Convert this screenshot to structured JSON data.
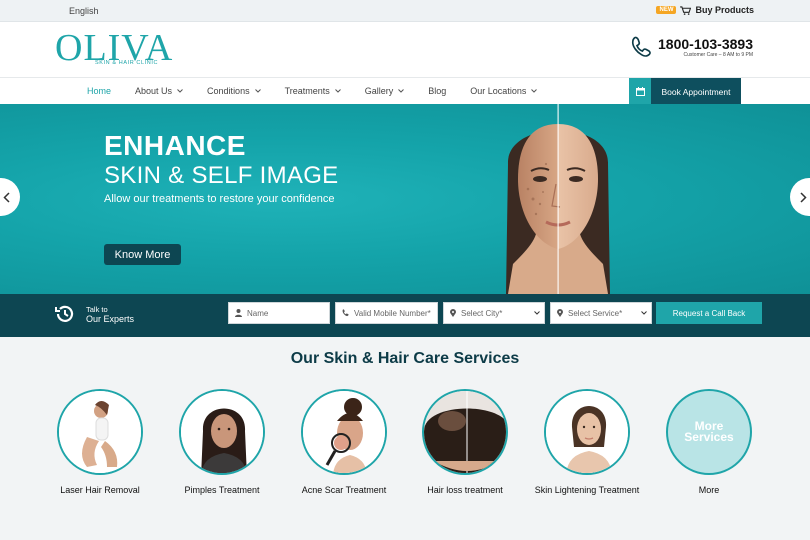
{
  "topbar": {
    "language": "English",
    "new_badge": "NEW",
    "buy_products": "Buy Products"
  },
  "brand": {
    "logo_word": "OLIVA",
    "tagline": "SKIN & HAIR CLINIC"
  },
  "contact": {
    "phone": "1800-103-3893",
    "hours": "Customer Care – 8 AM to 9 PM"
  },
  "nav": {
    "items": [
      {
        "label": "Home",
        "active": true,
        "dropdown": false
      },
      {
        "label": "About Us",
        "dropdown": true
      },
      {
        "label": "Conditions",
        "dropdown": true
      },
      {
        "label": "Treatments",
        "dropdown": true
      },
      {
        "label": "Gallery",
        "dropdown": true
      },
      {
        "label": "Blog",
        "dropdown": false
      },
      {
        "label": "Our Locations",
        "dropdown": true
      }
    ],
    "book_appointment": "Book Appointment"
  },
  "hero": {
    "line1": "ENHANCE",
    "line2": "SKIN & SELF IMAGE",
    "subtitle": "Allow our treatments to restore your confidence",
    "cta": "Know More"
  },
  "callback": {
    "talk_line1": "Talk to",
    "talk_line2": "Our Experts",
    "name_placeholder": "Name",
    "mobile_placeholder": "Valid Mobile Number*",
    "city_placeholder": "Select City*",
    "service_placeholder": "Select Service*",
    "submit": "Request a Call Back"
  },
  "services": {
    "heading": "Our Skin & Hair Care Services",
    "items": [
      {
        "label": "Laser Hair Removal"
      },
      {
        "label": "Pimples Treatment"
      },
      {
        "label": "Acne Scar Treatment"
      },
      {
        "label": "Hair loss treatment"
      },
      {
        "label": "Skin Lightening Treatment"
      },
      {
        "label": "More",
        "circle_text": "More Services"
      }
    ]
  },
  "colors": {
    "teal": "#1fa5a9",
    "dark_teal": "#0d4652",
    "heading": "#0d3b47",
    "badge": "#f5a623"
  }
}
